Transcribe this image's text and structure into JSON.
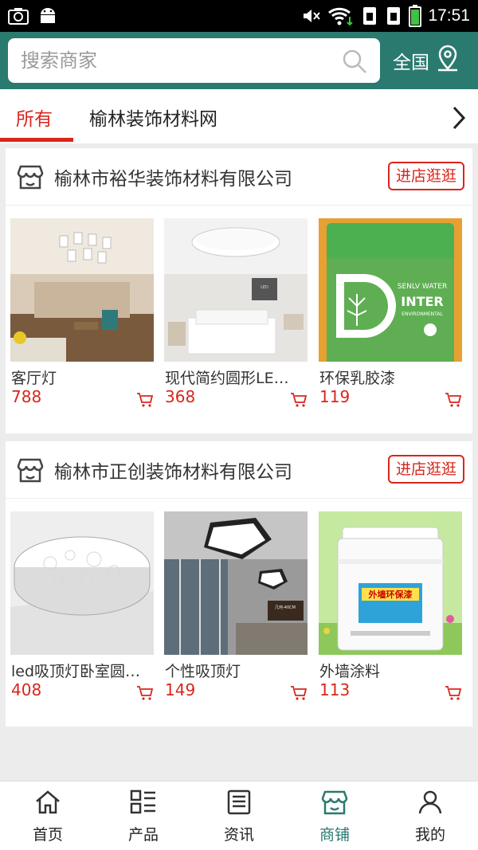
{
  "status_bar": {
    "time": "17:51"
  },
  "search": {
    "placeholder": "搜索商家",
    "region_label": "全国"
  },
  "tabs": [
    {
      "label": "所有",
      "active": true
    },
    {
      "label": "榆林装饰材料网",
      "active": false
    }
  ],
  "shops": [
    {
      "name": "榆林市裕华装饰材料有限公司",
      "enter_label": "进店逛逛",
      "products": [
        {
          "name": "客厅灯",
          "price": "788"
        },
        {
          "name": "现代简约圆形LE…",
          "price": "368"
        },
        {
          "name": "环保乳胶漆",
          "price": "119"
        }
      ]
    },
    {
      "name": "榆林市正创装饰材料有限公司",
      "enter_label": "进店逛逛",
      "products": [
        {
          "name": "led吸顶灯卧室圆…",
          "price": "408"
        },
        {
          "name": "个性吸顶灯",
          "price": "149"
        },
        {
          "name": "外墙涂料",
          "price": "113"
        }
      ]
    }
  ],
  "image_text": {
    "paint_bucket_brand": "SENLV WATER",
    "paint_bucket_inter": "INTER",
    "paint_bucket_sub": "ENVIRONMENTAL",
    "exterior_paint_label": "外墙环保漆",
    "lamp_size_label": "几何-40CM"
  },
  "bottom_nav": [
    {
      "label": "首页",
      "icon": "home-icon",
      "active": false
    },
    {
      "label": "产品",
      "icon": "grid-list-icon",
      "active": false
    },
    {
      "label": "资讯",
      "icon": "news-icon",
      "active": false
    },
    {
      "label": "商铺",
      "icon": "shop-icon",
      "active": true
    },
    {
      "label": "我的",
      "icon": "user-icon",
      "active": false
    }
  ],
  "colors": {
    "brand": "#2a7a70",
    "accent": "#d9261c"
  }
}
